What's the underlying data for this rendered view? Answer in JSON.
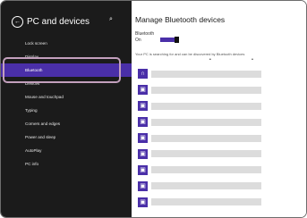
{
  "sidebar": {
    "title": "PC and devices",
    "back_glyph": "←",
    "search_glyph": "⌕",
    "items": [
      {
        "label": "Lock screen",
        "selected": false
      },
      {
        "label": "Display",
        "selected": false
      },
      {
        "label": "Bluetooth",
        "selected": true
      },
      {
        "label": "Devices",
        "selected": false
      },
      {
        "label": "Mouse and touchpad",
        "selected": false
      },
      {
        "label": "Typing",
        "selected": false
      },
      {
        "label": "Corners and edges",
        "selected": false
      },
      {
        "label": "Power and sleep",
        "selected": false
      },
      {
        "label": "AutoPlay",
        "selected": false
      },
      {
        "label": "PC info",
        "selected": false
      }
    ]
  },
  "main": {
    "title": "Manage Bluetooth devices",
    "bluetooth_label": "Bluetooth",
    "bluetooth_state": "On",
    "info": "Your PC is searching for and can be discovered by Bluetooth devices",
    "marks": "• •",
    "devices": [
      {
        "icon": "headphones-icon",
        "glyph": "∩"
      },
      {
        "icon": "device-icon",
        "glyph": "▣"
      },
      {
        "icon": "device-icon",
        "glyph": "▣"
      },
      {
        "icon": "device-icon",
        "glyph": "▣"
      },
      {
        "icon": "device-icon",
        "glyph": "▣"
      },
      {
        "icon": "device-icon",
        "glyph": "▣"
      },
      {
        "icon": "device-icon",
        "glyph": "▣"
      },
      {
        "icon": "device-icon",
        "glyph": "▣"
      },
      {
        "icon": "device-icon",
        "glyph": "▣"
      }
    ]
  },
  "colors": {
    "accent": "#4a2fa8",
    "sidebar_bg": "#1b1b1b",
    "highlight_ring": "#c3a0bd"
  }
}
